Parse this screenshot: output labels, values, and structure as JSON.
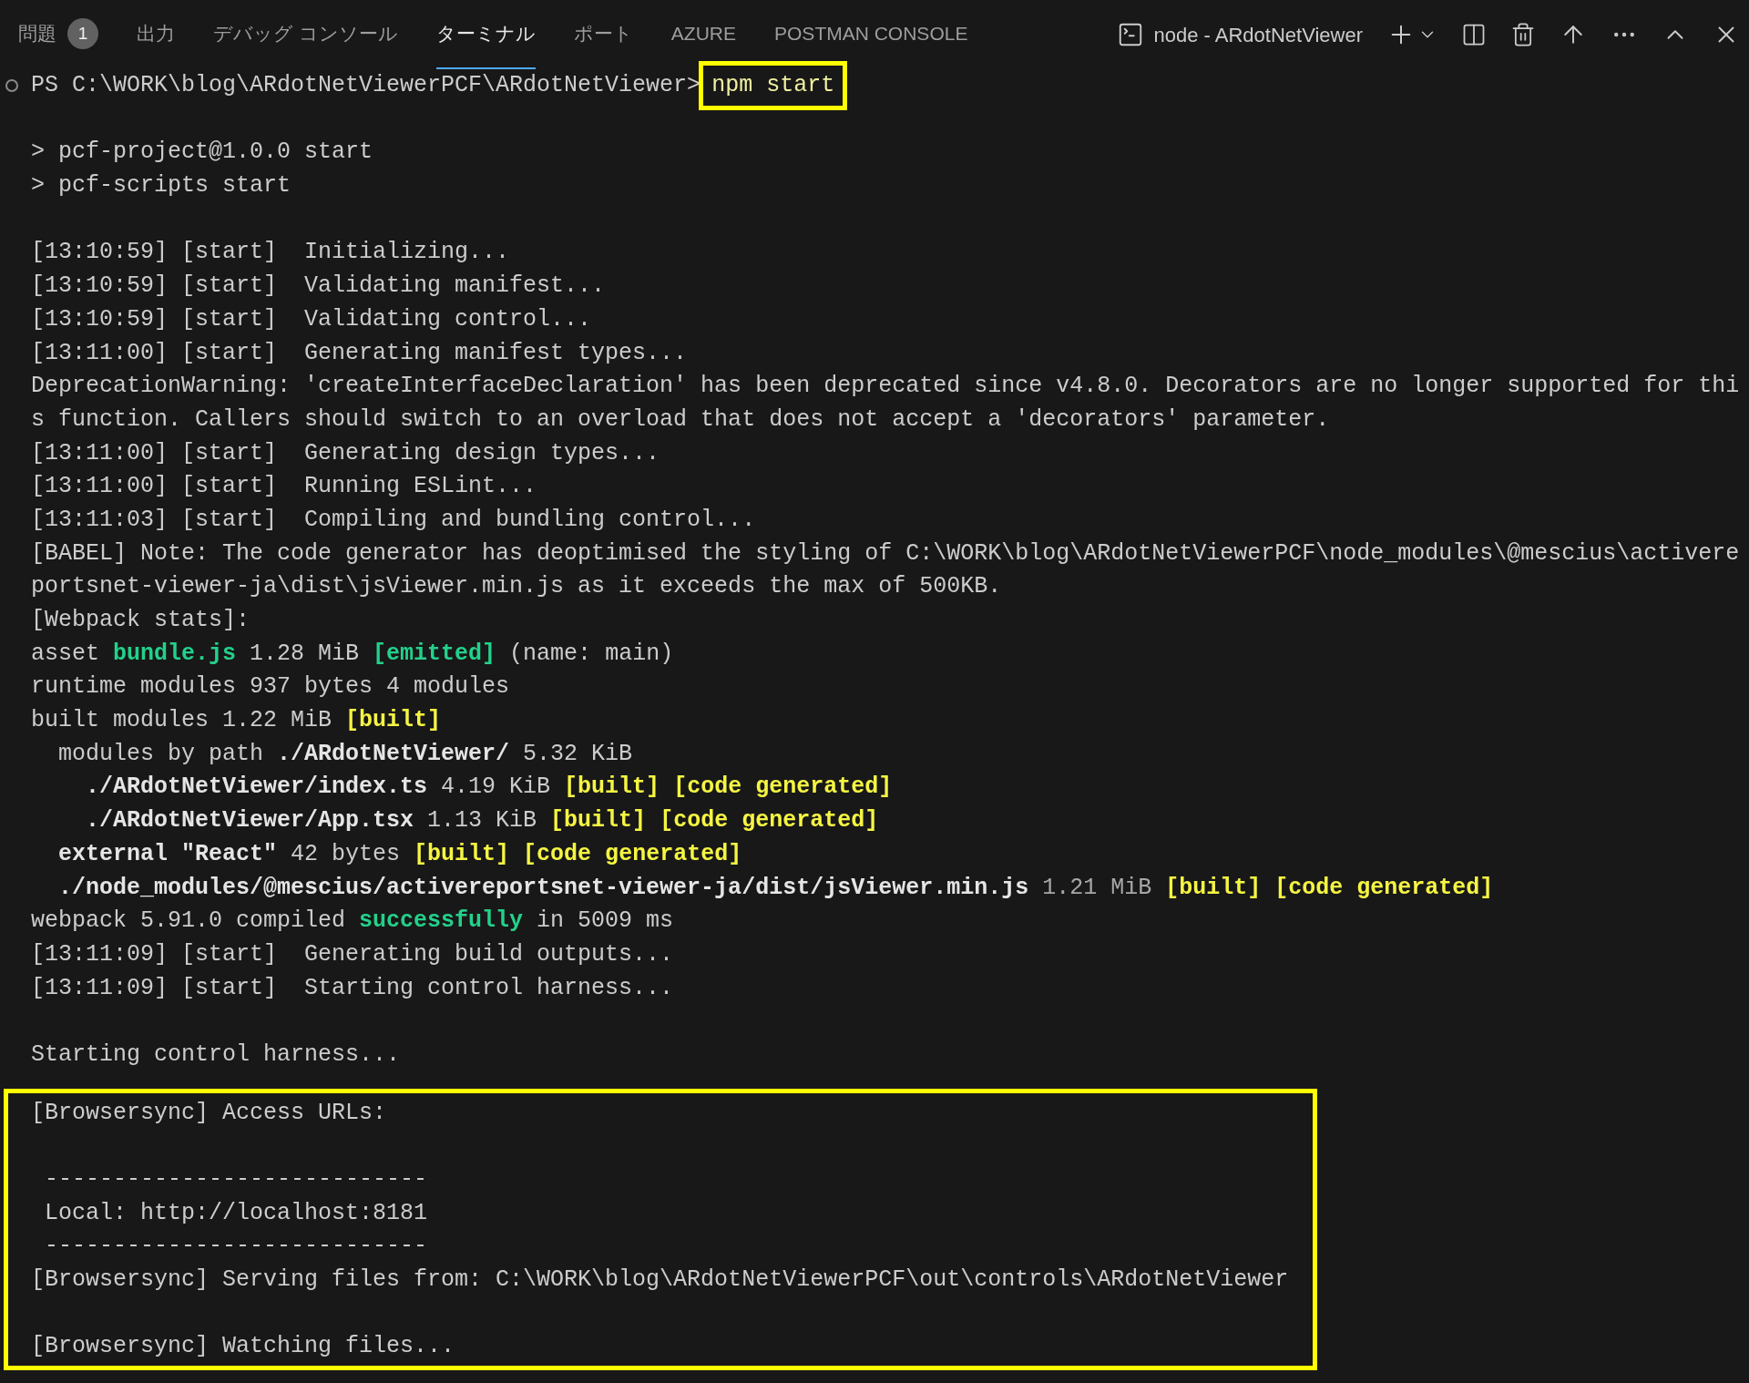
{
  "panel_tabs": [
    {
      "label": "問題",
      "badge": "1",
      "selected": false
    },
    {
      "label": "出力",
      "selected": false
    },
    {
      "label": "デバッグ コンソール",
      "selected": false
    },
    {
      "label": "ターミナル",
      "selected": true
    },
    {
      "label": "ポート",
      "selected": false
    },
    {
      "label": "AZURE",
      "selected": false
    },
    {
      "label": "POSTMAN CONSOLE",
      "selected": false
    }
  ],
  "terminal_selector": {
    "label": "node - ARdotNetViewer"
  },
  "terminal": {
    "prompt": "PS C:\\WORK\\blog\\ARdotNetViewerPCF\\ARdotNetViewer>",
    "command": "npm start",
    "command_highlighted": true,
    "lines": [
      {
        "kind": "blank"
      },
      {
        "kind": "text",
        "segments": [
          {
            "text": "> pcf-project@1.0.0 start",
            "kind": "plain"
          }
        ]
      },
      {
        "kind": "text",
        "segments": [
          {
            "text": "> pcf-scripts start",
            "kind": "plain"
          }
        ]
      },
      {
        "kind": "blank"
      },
      {
        "kind": "text",
        "segments": [
          {
            "text": "[13:10:59] [start]  Initializing...",
            "kind": "plain"
          }
        ]
      },
      {
        "kind": "text",
        "segments": [
          {
            "text": "[13:10:59] [start]  Validating manifest...",
            "kind": "plain"
          }
        ]
      },
      {
        "kind": "text",
        "segments": [
          {
            "text": "[13:10:59] [start]  Validating control...",
            "kind": "plain"
          }
        ]
      },
      {
        "kind": "text",
        "segments": [
          {
            "text": "[13:11:00] [start]  Generating manifest types...",
            "kind": "plain"
          }
        ]
      },
      {
        "kind": "text",
        "segments": [
          {
            "text": "DeprecationWarning: 'createInterfaceDeclaration' has been deprecated since v4.8.0. Decorators are no longer supported for thi",
            "kind": "plain"
          }
        ]
      },
      {
        "kind": "text",
        "segments": [
          {
            "text": "s function. Callers should switch to an overload that does not accept a 'decorators' parameter.",
            "kind": "plain"
          }
        ]
      },
      {
        "kind": "text",
        "segments": [
          {
            "text": "[13:11:00] [start]  Generating design types...",
            "kind": "plain"
          }
        ]
      },
      {
        "kind": "text",
        "segments": [
          {
            "text": "[13:11:00] [start]  Running ESLint...",
            "kind": "plain"
          }
        ]
      },
      {
        "kind": "text",
        "segments": [
          {
            "text": "[13:11:03] [start]  Compiling and bundling control...",
            "kind": "plain"
          }
        ]
      },
      {
        "kind": "text",
        "segments": [
          {
            "text": "[BABEL] Note: The code generator has deoptimised the styling of C:\\WORK\\blog\\ARdotNetViewerPCF\\node_modules\\@mescius\\activere",
            "kind": "plain"
          }
        ]
      },
      {
        "kind": "text",
        "segments": [
          {
            "text": "portsnet-viewer-ja\\dist\\jsViewer.min.js as it exceeds the max of 500KB.",
            "kind": "plain"
          }
        ]
      },
      {
        "kind": "text",
        "segments": [
          {
            "text": "[Webpack stats]:",
            "kind": "plain"
          }
        ]
      },
      {
        "kind": "text",
        "segments": [
          {
            "text": "asset ",
            "kind": "plain"
          },
          {
            "text": "bundle.js",
            "kind": "green"
          },
          {
            "text": " 1.28 MiB ",
            "kind": "plain"
          },
          {
            "text": "[emitted]",
            "kind": "green"
          },
          {
            "text": " (name: main)",
            "kind": "plain"
          }
        ]
      },
      {
        "kind": "text",
        "segments": [
          {
            "text": "runtime modules 937 bytes 4 modules",
            "kind": "plain"
          }
        ]
      },
      {
        "kind": "text",
        "segments": [
          {
            "text": "built modules 1.22 MiB ",
            "kind": "plain"
          },
          {
            "text": "[built]",
            "kind": "yellow"
          }
        ]
      },
      {
        "kind": "text",
        "segments": [
          {
            "text": "  modules by path ",
            "kind": "plain"
          },
          {
            "text": "./ARdotNetViewer/",
            "kind": "bold"
          },
          {
            "text": " 5.32 KiB",
            "kind": "plain"
          }
        ]
      },
      {
        "kind": "text",
        "segments": [
          {
            "text": "    ./ARdotNetViewer/index.ts",
            "kind": "bold"
          },
          {
            "text": " 4.19 KiB ",
            "kind": "plain"
          },
          {
            "text": "[built] ",
            "kind": "yellow"
          },
          {
            "text": "[code generated]",
            "kind": "yellow"
          }
        ]
      },
      {
        "kind": "text",
        "segments": [
          {
            "text": "    ./ARdotNetViewer/App.tsx",
            "kind": "bold"
          },
          {
            "text": " 1.13 KiB ",
            "kind": "plain"
          },
          {
            "text": "[built] ",
            "kind": "yellow"
          },
          {
            "text": "[code generated]",
            "kind": "yellow"
          }
        ]
      },
      {
        "kind": "text",
        "segments": [
          {
            "text": "  external \"React\"",
            "kind": "bold"
          },
          {
            "text": " 42 bytes ",
            "kind": "plain"
          },
          {
            "text": "[built] ",
            "kind": "yellow"
          },
          {
            "text": "[code generated]",
            "kind": "yellow"
          }
        ]
      },
      {
        "kind": "text",
        "segments": [
          {
            "text": "  ./node_modules/@mescius/activereportsnet-viewer-ja/dist/jsViewer.min.js",
            "kind": "bold"
          },
          {
            "text": " 1.21 MiB ",
            "kind": "dim"
          },
          {
            "text": "[built] ",
            "kind": "yellow"
          },
          {
            "text": "[code generated]",
            "kind": "yellow"
          }
        ]
      },
      {
        "kind": "text",
        "segments": [
          {
            "text": "webpack 5.91.0 compiled ",
            "kind": "plain"
          },
          {
            "text": "successfully",
            "kind": "green"
          },
          {
            "text": " in 5009 ms",
            "kind": "plain"
          }
        ]
      },
      {
        "kind": "text",
        "segments": [
          {
            "text": "[13:11:09] [start]  Generating build outputs...",
            "kind": "plain"
          }
        ]
      },
      {
        "kind": "text",
        "segments": [
          {
            "text": "[13:11:09] [start]  Starting control harness...",
            "kind": "plain"
          }
        ]
      },
      {
        "kind": "blank"
      },
      {
        "kind": "text",
        "segments": [
          {
            "text": "Starting control harness...",
            "kind": "plain"
          }
        ]
      }
    ],
    "highlighted_block": {
      "lines": [
        {
          "kind": "text",
          "text": "[Browsersync] Access URLs:"
        },
        {
          "kind": "blank"
        },
        {
          "kind": "text",
          "text": " ----------------------------"
        },
        {
          "kind": "text",
          "text": " Local: http://localhost:8181"
        },
        {
          "kind": "text",
          "text": " ----------------------------"
        },
        {
          "kind": "text",
          "text": "[Browsersync] Serving files from: C:\\WORK\\blog\\ARdotNetViewerPCF\\out\\controls\\ARdotNetViewer"
        },
        {
          "kind": "blank"
        },
        {
          "kind": "text",
          "text": "[Browsersync] Watching files..."
        }
      ]
    }
  }
}
